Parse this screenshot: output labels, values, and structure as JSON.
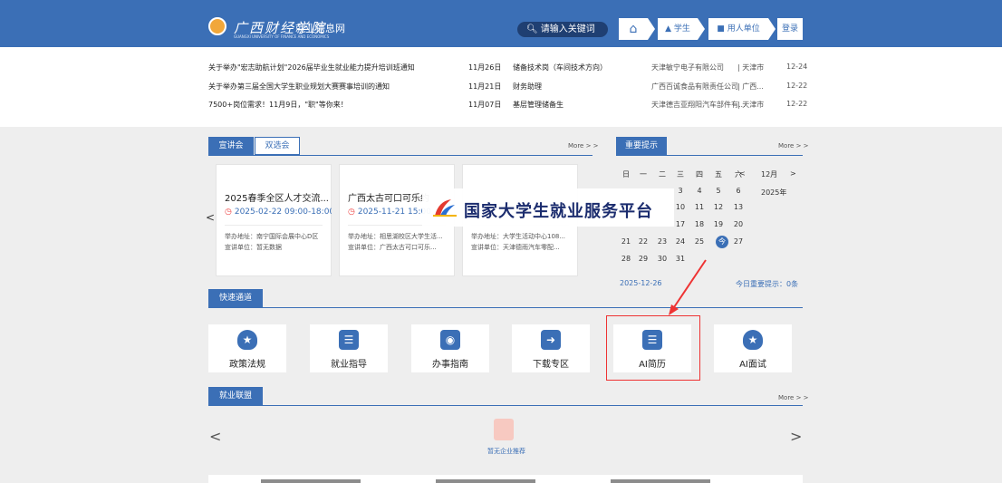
{
  "header": {
    "school_name": "广西财经学院",
    "school_sub_en": "GUANGXI UNIVERSITY OF FINANCE AND ECONOMICS",
    "site_name": "就业信息网",
    "search_placeholder": "请输入关键词",
    "nav": {
      "home_icon": "home-icon",
      "student": "学生",
      "employer": "用人单位",
      "login": "登录"
    }
  },
  "news_rows": [
    {
      "title": "关于举办\"宏志助航计划\"2026届毕业生就业能力提升培训班通知",
      "date": "11月26日",
      "job": "储备技术岗（车间技术方向）",
      "company": "天津敏宁电子有限公司",
      "city": "| 天津市",
      "pub": "12-24"
    },
    {
      "title": "关于举办第三届全国大学生职业规划大赛赛事培训的通知",
      "date": "11月21日",
      "job": "财务助理",
      "company": "广西百诚食品有限责任公司",
      "city": "| 广西...",
      "pub": "12-22"
    },
    {
      "title": "7500+岗位需求！11月9日，\"职\"等你来！",
      "date": "11月07日",
      "job": "基层管理储备生",
      "company": "天津德吉亚翔阳汽车部件有...",
      "city": "| 天津市",
      "pub": "12-22"
    }
  ],
  "talks": {
    "tab_active": "宣讲会",
    "tab_inactive": "双选会",
    "more": "More > >",
    "cards": [
      {
        "title": "2025春季全区人才交流...",
        "time": "2025-02-22 09:00-18:00",
        "addr": "举办地址：南宁国际会展中心D区",
        "unit": "宣讲单位：暂无数据"
      },
      {
        "title": "广西太古可口可乐约",
        "time": "2025-11-21 15:00",
        "addr": "举办地址：相思湖校区大学生活...",
        "unit": "宣讲单位：广西太古可口可乐..."
      },
      {
        "title": "",
        "time": "",
        "addr": "举办地址：大学生活动中心108...",
        "unit": "宣讲单位：天津德雨汽车零配..."
      }
    ]
  },
  "important": {
    "title": "重要提示",
    "more": "More > >",
    "calendar": {
      "weekdays": [
        "日",
        "一",
        "二",
        "三",
        "四",
        "五",
        "六"
      ],
      "month": "12月",
      "year": "2025年",
      "rows": [
        [
          "",
          "",
          "",
          "3",
          "4",
          "5",
          "6"
        ],
        [
          "",
          "",
          "",
          "10",
          "11",
          "12",
          "13"
        ],
        [
          "",
          "",
          "",
          "17",
          "18",
          "19",
          "20"
        ],
        [
          "21",
          "22",
          "23",
          "24",
          "25",
          "今",
          "27"
        ],
        [
          "28",
          "29",
          "30",
          "31",
          "",
          "",
          ""
        ]
      ]
    },
    "date": "2025-12-26",
    "today_tip": "今日重要提示：0条"
  },
  "banner": {
    "text": "国家大学生就业服务平台"
  },
  "quick_access": {
    "title": "快速通道",
    "items": [
      {
        "label": "政策法规",
        "icon": "star-shield-icon"
      },
      {
        "label": "就业指导",
        "icon": "document-icon"
      },
      {
        "label": "办事指南",
        "icon": "calendar-search-icon"
      },
      {
        "label": "下载专区",
        "icon": "folder-download-icon"
      },
      {
        "label": "AI简历",
        "icon": "document-icon"
      },
      {
        "label": "AI面试",
        "icon": "star-shield-icon"
      }
    ]
  },
  "alliance": {
    "title": "就业联盟",
    "more": "More > >",
    "empty": "暂无企业推荐"
  }
}
